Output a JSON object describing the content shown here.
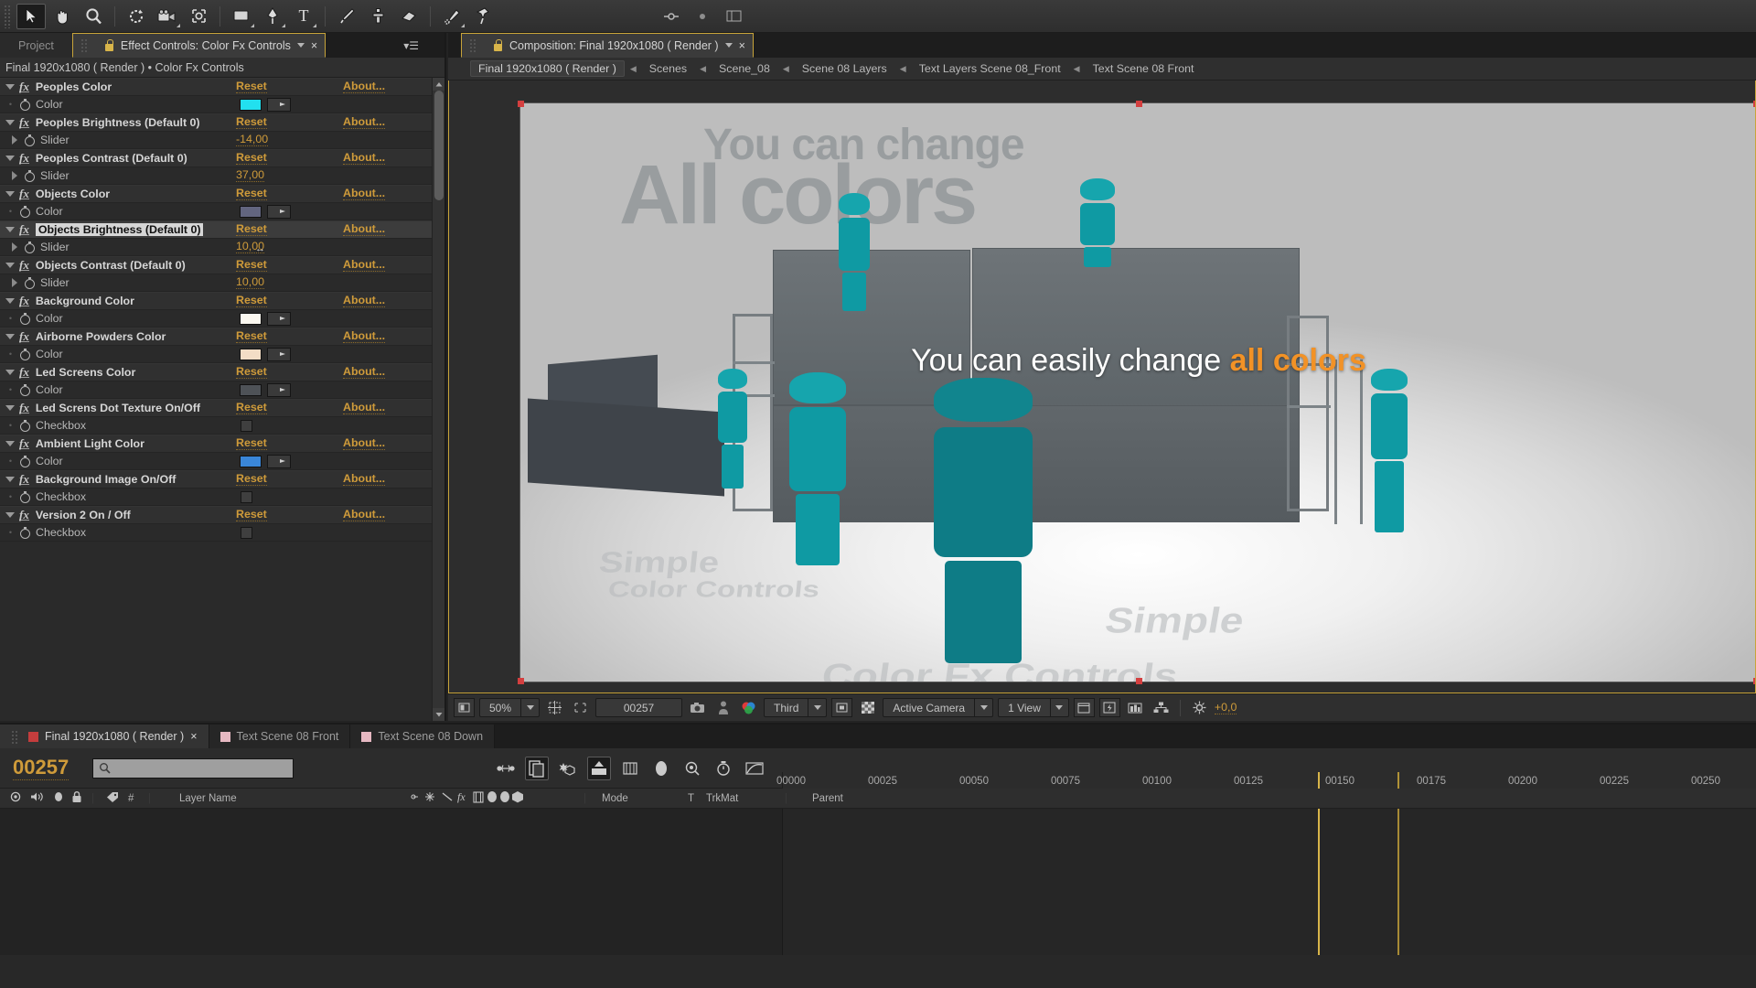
{
  "toolbar": {
    "tools": [
      {
        "name": "selection-tool",
        "glyph": "arrow",
        "active": true
      },
      {
        "name": "hand-tool",
        "glyph": "hand",
        "active": false
      },
      {
        "name": "zoom-tool",
        "glyph": "magnifier",
        "active": false
      },
      {
        "name": "rotation-tool",
        "glyph": "rotate",
        "active": false
      },
      {
        "name": "camera-tool",
        "glyph": "camera",
        "active": false
      },
      {
        "name": "pan-behind-tool",
        "glyph": "anchor",
        "active": false
      },
      {
        "name": "shape-tool",
        "glyph": "rect",
        "active": false
      },
      {
        "name": "pen-tool",
        "glyph": "pen",
        "active": false
      },
      {
        "name": "type-tool",
        "glyph": "T",
        "active": false
      },
      {
        "name": "brush-tool",
        "glyph": "brush",
        "active": false
      },
      {
        "name": "clone-stamp-tool",
        "glyph": "stamp",
        "active": false
      },
      {
        "name": "eraser-tool",
        "glyph": "eraser",
        "active": false
      },
      {
        "name": "roto-brush-tool",
        "glyph": "roto",
        "active": false
      },
      {
        "name": "puppet-pin-tool",
        "glyph": "pin",
        "active": false
      }
    ],
    "right_tools": [
      {
        "name": "snapping-toggle",
        "glyph": "snap"
      },
      {
        "name": "workspace-dot",
        "glyph": "dot"
      },
      {
        "name": "workspace-menu",
        "glyph": "panel"
      }
    ]
  },
  "effect_controls": {
    "tabs": {
      "project_label": "Project",
      "active_label": "Effect Controls: Color Fx Controls",
      "close_glyph": "×",
      "swatch_color": "#c43d3d"
    },
    "breadcrumb": "Final 1920x1080 ( Render ) • Color Fx Controls",
    "reset_label": "Reset",
    "about_label": "About...",
    "rows": [
      {
        "type": "effect",
        "label": "Peoples Color",
        "reset": "Reset",
        "about": "About...",
        "selected": false
      },
      {
        "type": "color",
        "label": "Color",
        "swatch": "#22e0ef"
      },
      {
        "type": "effect",
        "label": "Peoples Brightness (Default 0)",
        "reset": "Reset",
        "about": "About...",
        "selected": false
      },
      {
        "type": "slider",
        "label": "Slider",
        "value": "-14,00"
      },
      {
        "type": "effect",
        "label": "Peoples Contrast (Default 0)",
        "reset": "Reset",
        "about": "About...",
        "selected": false
      },
      {
        "type": "slider",
        "label": "Slider",
        "value": "37,00"
      },
      {
        "type": "effect",
        "label": "Objects Color",
        "reset": "Reset",
        "about": "About...",
        "selected": false
      },
      {
        "type": "color",
        "label": "Color",
        "swatch": "#62657f"
      },
      {
        "type": "effect",
        "label": "Objects Brightness (Default 0)",
        "reset": "Reset",
        "about": "About...",
        "selected": true
      },
      {
        "type": "slider",
        "label": "Slider",
        "value": "10,00",
        "cursor": true
      },
      {
        "type": "effect",
        "label": "Objects Contrast (Default 0)",
        "reset": "Reset",
        "about": "About...",
        "selected": false
      },
      {
        "type": "slider",
        "label": "Slider",
        "value": "10,00"
      },
      {
        "type": "effect",
        "label": "Background Color",
        "reset": "Reset",
        "about": "About...",
        "selected": false
      },
      {
        "type": "color",
        "label": "Color",
        "swatch": "#fbf8f0"
      },
      {
        "type": "effect",
        "label": "Airborne Powders Color",
        "reset": "Reset",
        "about": "About...",
        "selected": false
      },
      {
        "type": "color",
        "label": "Color",
        "swatch": "#f3ddc6"
      },
      {
        "type": "effect",
        "label": "Led Screens Color",
        "reset": "Reset",
        "about": "About...",
        "selected": false
      },
      {
        "type": "color",
        "label": "Color",
        "swatch": "#4e5257"
      },
      {
        "type": "effect",
        "label": "Led Screns Dot Texture  On/Off",
        "reset": "Reset",
        "about": "About...",
        "selected": false
      },
      {
        "type": "checkbox",
        "label": "Checkbox",
        "checked": false
      },
      {
        "type": "effect",
        "label": "Ambient Light Color",
        "reset": "Reset",
        "about": "About...",
        "selected": false
      },
      {
        "type": "color",
        "label": "Color",
        "swatch": "#3a86d8"
      },
      {
        "type": "effect",
        "label": "Background Image  On/Off",
        "reset": "Reset",
        "about": "About...",
        "selected": false
      },
      {
        "type": "checkbox",
        "label": "Checkbox",
        "checked": false
      },
      {
        "type": "effect",
        "label": "Version 2  On / Off",
        "reset": "Reset",
        "about": "About...",
        "selected": false
      },
      {
        "type": "checkbox",
        "label": "Checkbox",
        "checked": false
      }
    ]
  },
  "composition": {
    "tab_label": "Composition: Final 1920x1080 ( Render )",
    "tab_swatch": "#c43d3d",
    "close_glyph": "×",
    "breadcrumbs": [
      "Final 1920x1080 ( Render )",
      "Scenes",
      "Scene_08",
      "Scene 08 Layers",
      "Text Layers Scene 08_Front",
      "Text Scene 08 Front"
    ],
    "canvas": {
      "bg_headline_small": "You can change",
      "bg_headline_large": "All colors",
      "floor_text_1": "Simple",
      "floor_text_2": "Color Controls",
      "floor_text_3": "Simple",
      "floor_text_4": "Color Fx Controls",
      "overlay_prefix": "You can easily change ",
      "overlay_accent": "all colors",
      "accent_color": "#f29226",
      "people_color": "#16a5ad"
    },
    "toolbar": {
      "zoom": "50%",
      "timecode": "00257",
      "resolution": "Third",
      "camera": "Active Camera",
      "views": "1 View",
      "exposure": "+0,0"
    }
  },
  "timeline": {
    "tabs": [
      {
        "label": "Final 1920x1080 ( Render )",
        "swatch": "#c43d3d",
        "active": true,
        "close": "×"
      },
      {
        "label": "Text Scene 08 Front",
        "swatch": "#e6b8c2",
        "active": false
      },
      {
        "label": "Text Scene 08 Down",
        "swatch": "#e6b8c2",
        "active": false
      }
    ],
    "timecode": "00257",
    "search_placeholder": "",
    "columns": [
      "#",
      "Layer Name",
      "Mode",
      "T",
      "TrkMat",
      "Parent"
    ],
    "ruler_ticks": [
      "00000",
      "00025",
      "00050",
      "00075",
      "00100",
      "00125",
      "00150",
      "00175",
      "00200",
      "00225",
      "00250"
    ],
    "switches": [
      {
        "name": "video-switch"
      },
      {
        "name": "audio-switch"
      },
      {
        "name": "solo-switch"
      },
      {
        "name": "lock-switch"
      }
    ],
    "layer_switch_icons": [
      "shy",
      "effects-fx",
      "motion-blur",
      "adjustment",
      "3d-layer",
      "collapse"
    ]
  }
}
